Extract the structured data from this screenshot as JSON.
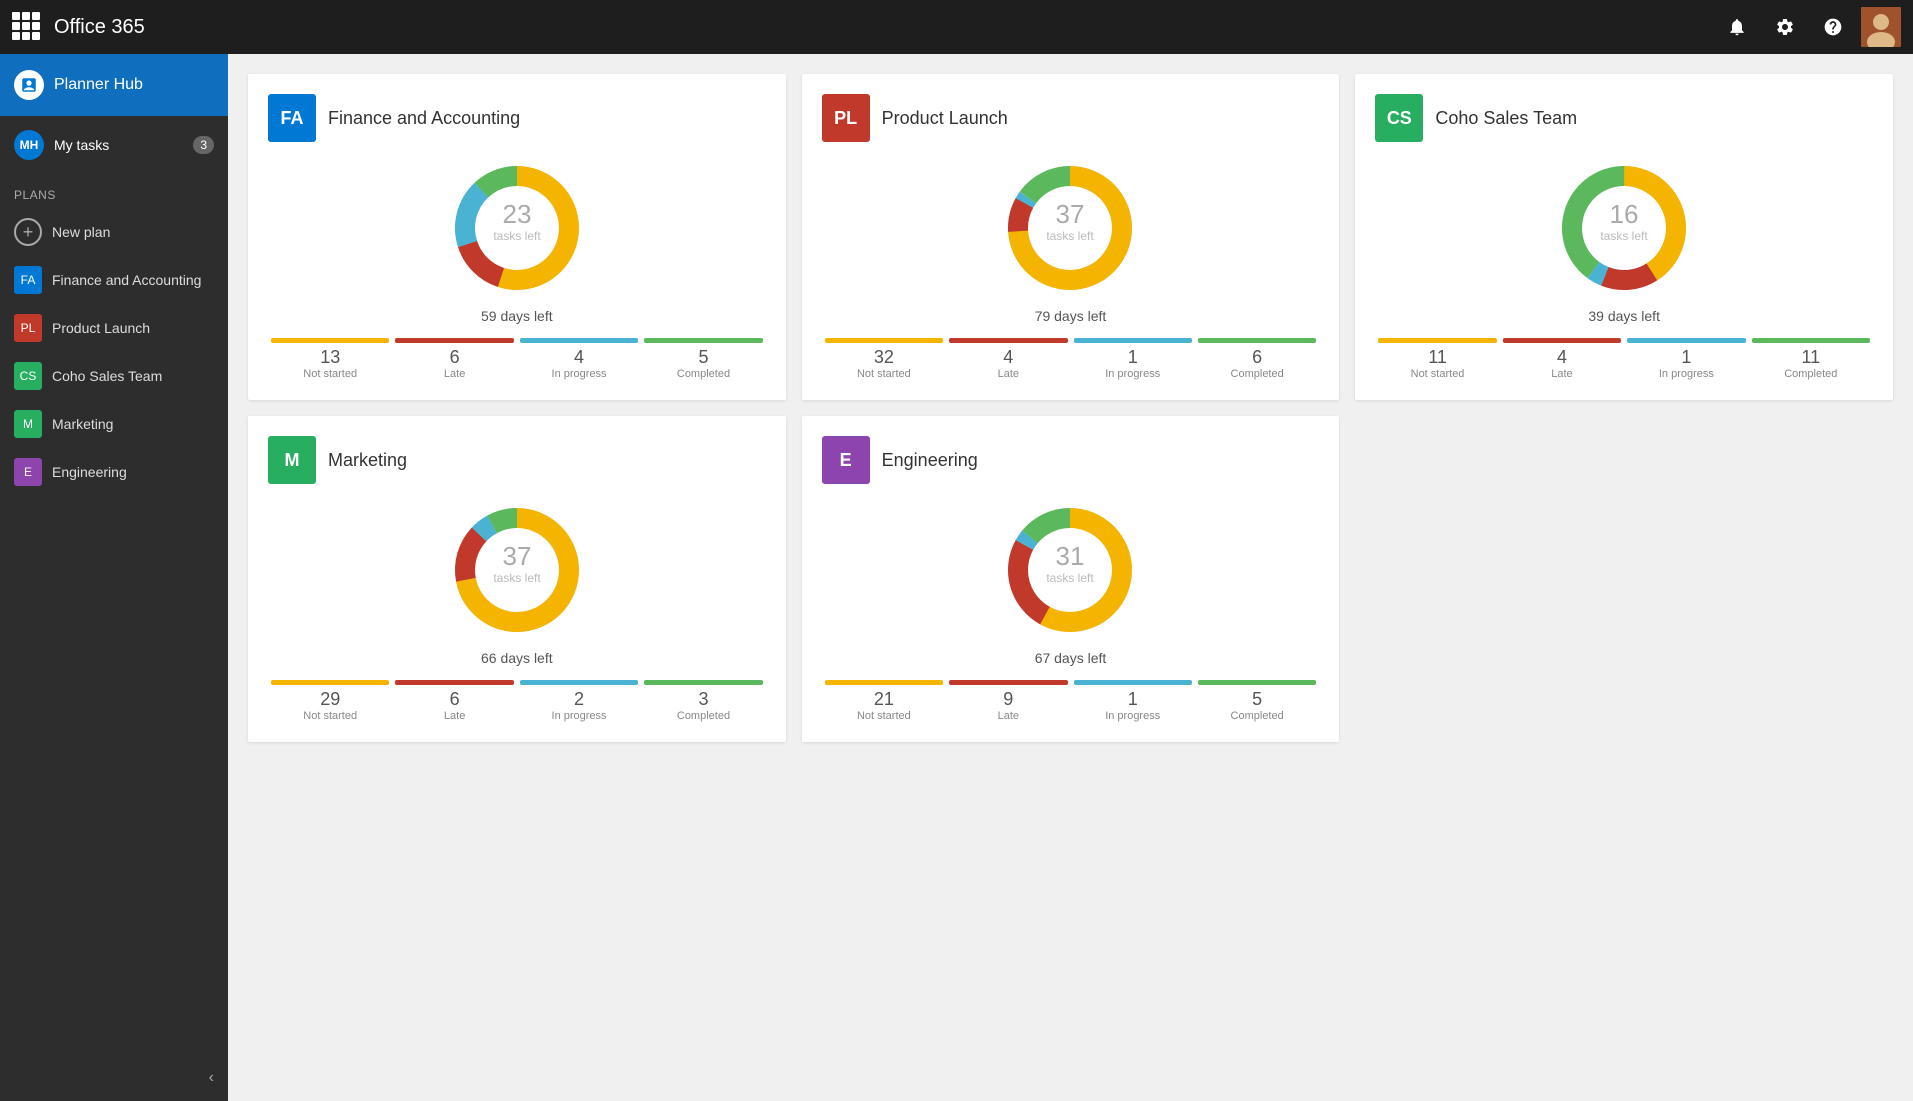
{
  "topbar": {
    "title": "Office 365",
    "icons": {
      "bell": "🔔",
      "gear": "⚙",
      "help": "?"
    }
  },
  "sidebar": {
    "planner_hub_label": "Planner Hub",
    "my_tasks_label": "My tasks",
    "my_tasks_count": "3",
    "my_tasks_initials": "MH",
    "plans_label": "Plans",
    "new_plan_label": "New plan",
    "items": [
      {
        "id": "finance",
        "abbr": "FA",
        "label": "Finance and Accounting",
        "color": "#0078d4"
      },
      {
        "id": "product-launch",
        "abbr": "PL",
        "label": "Product Launch",
        "color": "#c0392b"
      },
      {
        "id": "coho-sales",
        "abbr": "CS",
        "label": "Coho Sales Team",
        "color": "#27ae60"
      },
      {
        "id": "marketing",
        "abbr": "M",
        "label": "Marketing",
        "color": "#27ae60"
      },
      {
        "id": "engineering",
        "abbr": "E",
        "label": "Engineering",
        "color": "#8e44ad"
      }
    ]
  },
  "cards": [
    {
      "id": "finance",
      "abbr": "FA",
      "title": "Finance and Accounting",
      "color": "#0078d4",
      "tasks_left": "23",
      "tasks_left_label": "tasks left",
      "days_left": "59 days left",
      "donut": {
        "yellow": 55,
        "red": 15,
        "blue": 18,
        "green": 12
      },
      "stats": [
        {
          "num": "13",
          "label": "Not started",
          "color": "yellow"
        },
        {
          "num": "6",
          "label": "Late",
          "color": "red"
        },
        {
          "num": "4",
          "label": "In progress",
          "color": "blue"
        },
        {
          "num": "5",
          "label": "Completed",
          "color": "green"
        }
      ]
    },
    {
      "id": "product-launch",
      "abbr": "PL",
      "title": "Product Launch",
      "color": "#c0392b",
      "tasks_left": "37",
      "tasks_left_label": "tasks left",
      "days_left": "79 days left",
      "donut": {
        "yellow": 74,
        "red": 9,
        "blue": 2,
        "green": 15
      },
      "stats": [
        {
          "num": "32",
          "label": "Not started",
          "color": "yellow"
        },
        {
          "num": "4",
          "label": "Late",
          "color": "red"
        },
        {
          "num": "1",
          "label": "In progress",
          "color": "blue"
        },
        {
          "num": "6",
          "label": "Completed",
          "color": "green"
        }
      ]
    },
    {
      "id": "coho-sales",
      "abbr": "CS",
      "title": "Coho Sales Team",
      "color": "#27ae60",
      "tasks_left": "16",
      "tasks_left_label": "tasks left",
      "days_left": "39 days left",
      "donut": {
        "yellow": 41,
        "red": 15,
        "blue": 4,
        "green": 40
      },
      "stats": [
        {
          "num": "11",
          "label": "Not started",
          "color": "yellow"
        },
        {
          "num": "4",
          "label": "Late",
          "color": "red"
        },
        {
          "num": "1",
          "label": "In progress",
          "color": "blue"
        },
        {
          "num": "11",
          "label": "Completed",
          "color": "green"
        }
      ]
    },
    {
      "id": "marketing",
      "abbr": "M",
      "title": "Marketing",
      "color": "#27ae60",
      "tasks_left": "37",
      "tasks_left_label": "tasks left",
      "days_left": "66 days left",
      "donut": {
        "yellow": 72,
        "red": 15,
        "blue": 5,
        "green": 8
      },
      "stats": [
        {
          "num": "29",
          "label": "Not started",
          "color": "yellow"
        },
        {
          "num": "6",
          "label": "Late",
          "color": "red"
        },
        {
          "num": "2",
          "label": "In progress",
          "color": "blue"
        },
        {
          "num": "3",
          "label": "Completed",
          "color": "green"
        }
      ]
    },
    {
      "id": "engineering",
      "abbr": "E",
      "title": "Engineering",
      "color": "#8e44ad",
      "tasks_left": "31",
      "tasks_left_label": "tasks left",
      "days_left": "67 days left",
      "donut": {
        "yellow": 58,
        "red": 25,
        "blue": 3,
        "green": 14
      },
      "stats": [
        {
          "num": "21",
          "label": "Not started",
          "color": "yellow"
        },
        {
          "num": "9",
          "label": "Late",
          "color": "red"
        },
        {
          "num": "1",
          "label": "In progress",
          "color": "blue"
        },
        {
          "num": "5",
          "label": "Completed",
          "color": "green"
        }
      ]
    }
  ]
}
